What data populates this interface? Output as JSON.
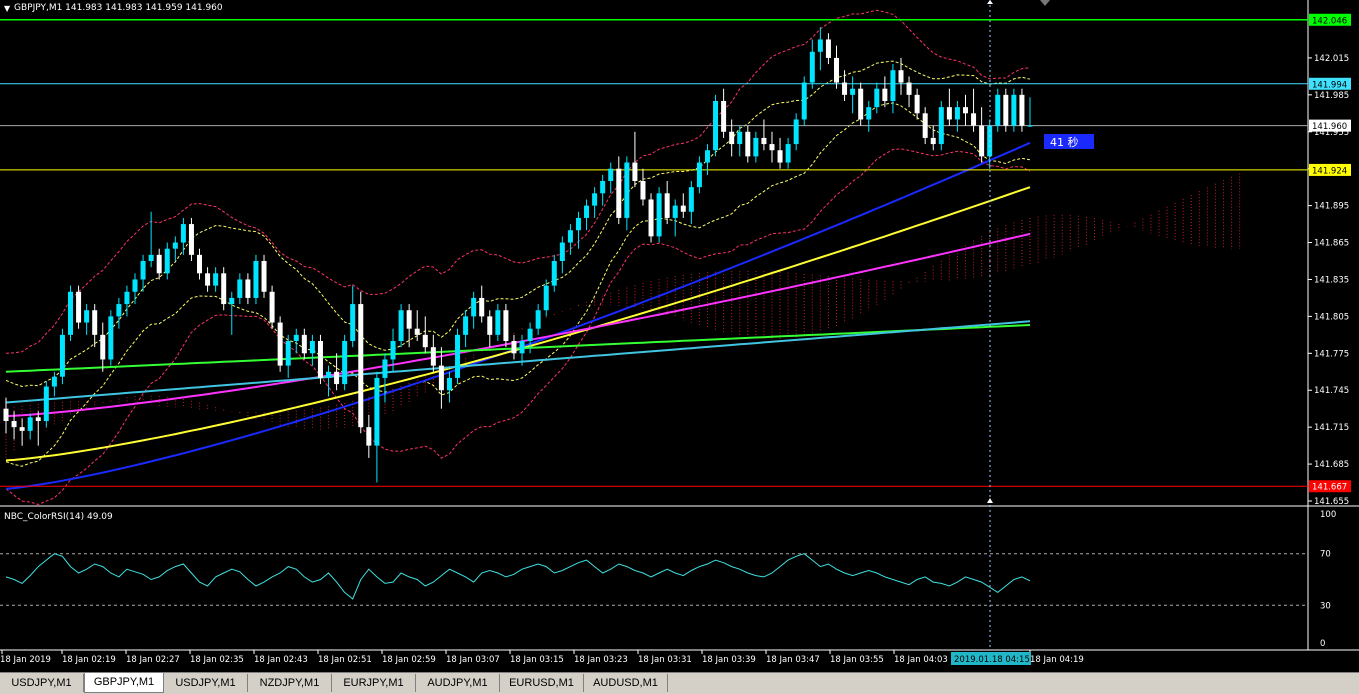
{
  "window": {
    "symbol_header": "GBPJPY,M1  141.983 141.983 141.959 141.960",
    "menu_glyph": "▼"
  },
  "price_scale": {
    "ticks": [
      "142.015",
      "141.985",
      "141.955",
      "141.925",
      "141.895",
      "141.865",
      "141.835",
      "141.805",
      "141.775",
      "141.745",
      "141.715",
      "141.685",
      "141.655"
    ],
    "label_green": "142.046",
    "label_cyan": "141.994",
    "label_current": "141.960",
    "label_yellow": "141.924",
    "label_red": "141.667"
  },
  "countdown": {
    "text": "41 秒"
  },
  "indicator": {
    "label": "NBC_ColorRSI(14) 49.09",
    "levels": [
      "100",
      "70",
      "30",
      "0"
    ]
  },
  "time_axis": {
    "labels": [
      "18 Jan 2019",
      "18 Jan 02:19",
      "18 Jan 02:27",
      "18 Jan 02:35",
      "18 Jan 02:43",
      "18 Jan 02:51",
      "18 Jan 02:59",
      "18 Jan 03:07",
      "18 Jan 03:15",
      "18 Jan 03:23",
      "18 Jan 03:31",
      "18 Jan 03:39",
      "18 Jan 03:47",
      "18 Jan 03:55",
      "18 Jan 04:03",
      "18 Jan 04:19"
    ],
    "crosshair_time": "2019.01.18 04:15"
  },
  "tabs": [
    {
      "label": "USDJPY,M1",
      "active": false
    },
    {
      "label": "GBPJPY,M1",
      "active": true
    },
    {
      "label": "USDJPY,M1",
      "active": false
    },
    {
      "label": "NZDJPY,M1",
      "active": false
    },
    {
      "label": "EURJPY,M1",
      "active": false
    },
    {
      "label": "AUDJPY,M1",
      "active": false
    },
    {
      "label": "EURUSD,M1",
      "active": false
    },
    {
      "label": "AUDUSD,M1",
      "active": false
    }
  ],
  "colors": {
    "bull": "#00e5ff",
    "bear": "#ffffff",
    "sma_fast": "#1a2aff",
    "sma_mid": "#ffff33",
    "sma_slow": "#ff33ff",
    "sma_long_green": "#33ff33",
    "sma_long_cyan": "#40c4e0",
    "bollinger": "#ff3366",
    "envelope": "#ffff66",
    "line_green": "#00ff00",
    "line_cyan": "#40e0ff",
    "line_yellow": "#ffff00",
    "line_red": "#ff0000",
    "rsi": "#40e0e0"
  },
  "chart_data": {
    "type": "candlestick",
    "timeframe": "M1",
    "symbol": "GBPJPY",
    "ylim": [
      141.655,
      142.045
    ],
    "horizontal_levels": {
      "green": 142.046,
      "cyan": 141.994,
      "current": 141.96,
      "yellow": 141.924,
      "red": 141.667
    },
    "candles": [
      [
        141.73,
        141.739,
        141.71,
        141.72
      ],
      [
        141.72,
        141.728,
        141.705,
        141.715
      ],
      [
        141.715,
        141.722,
        141.7,
        141.712
      ],
      [
        141.712,
        141.726,
        141.705,
        141.723
      ],
      [
        141.723,
        141.728,
        141.7,
        141.72
      ],
      [
        141.72,
        141.752,
        141.715,
        141.748
      ],
      [
        141.748,
        141.76,
        141.74,
        141.756
      ],
      [
        141.756,
        141.795,
        141.75,
        141.79
      ],
      [
        141.79,
        141.83,
        141.785,
        141.825
      ],
      [
        141.825,
        141.83,
        141.795,
        141.8
      ],
      [
        141.8,
        141.815,
        141.79,
        141.81
      ],
      [
        141.81,
        141.815,
        141.78,
        141.79
      ],
      [
        141.79,
        141.8,
        141.76,
        141.77
      ],
      [
        141.77,
        141.81,
        141.765,
        141.805
      ],
      [
        141.805,
        141.82,
        141.795,
        141.815
      ],
      [
        141.815,
        141.83,
        141.805,
        141.825
      ],
      [
        141.825,
        141.84,
        141.815,
        141.835
      ],
      [
        141.835,
        141.855,
        141.825,
        141.85
      ],
      [
        141.85,
        141.89,
        141.845,
        141.855
      ],
      [
        141.855,
        141.86,
        141.835,
        141.84
      ],
      [
        141.84,
        141.865,
        141.835,
        141.86
      ],
      [
        141.86,
        141.87,
        141.85,
        141.865
      ],
      [
        141.865,
        141.885,
        141.855,
        141.88
      ],
      [
        141.88,
        141.885,
        141.85,
        141.855
      ],
      [
        141.855,
        141.86,
        141.835,
        141.84
      ],
      [
        141.84,
        141.845,
        141.825,
        141.83
      ],
      [
        141.83,
        141.845,
        141.825,
        141.84
      ],
      [
        141.84,
        141.845,
        141.81,
        141.815
      ],
      [
        141.815,
        141.825,
        141.79,
        141.82
      ],
      [
        141.82,
        141.84,
        141.815,
        141.835
      ],
      [
        141.835,
        141.84,
        141.815,
        141.82
      ],
      [
        141.82,
        141.855,
        141.815,
        141.85
      ],
      [
        141.85,
        141.855,
        141.82,
        141.825
      ],
      [
        141.825,
        141.83,
        141.795,
        141.8
      ],
      [
        141.8,
        141.805,
        141.76,
        141.765
      ],
      [
        141.765,
        141.79,
        141.755,
        141.785
      ],
      [
        141.785,
        141.795,
        141.775,
        141.79
      ],
      [
        141.79,
        141.795,
        141.77,
        141.775
      ],
      [
        141.775,
        141.79,
        141.765,
        141.785
      ],
      [
        141.785,
        141.79,
        141.75,
        141.755
      ],
      [
        141.755,
        141.765,
        141.74,
        141.76
      ],
      [
        141.76,
        141.775,
        141.745,
        141.75
      ],
      [
        141.75,
        141.79,
        141.745,
        141.785
      ],
      [
        141.785,
        141.83,
        141.78,
        141.815
      ],
      [
        141.815,
        141.825,
        141.71,
        141.715
      ],
      [
        141.715,
        141.725,
        141.69,
        141.7
      ],
      [
        141.7,
        141.76,
        141.67,
        141.755
      ],
      [
        141.755,
        141.775,
        141.735,
        141.77
      ],
      [
        141.77,
        141.795,
        141.76,
        141.785
      ],
      [
        141.785,
        141.815,
        141.78,
        141.81
      ],
      [
        141.81,
        141.815,
        141.78,
        141.795
      ],
      [
        141.795,
        141.81,
        141.785,
        141.79
      ],
      [
        141.79,
        141.805,
        141.775,
        141.78
      ],
      [
        141.78,
        141.79,
        141.76,
        141.765
      ],
      [
        141.765,
        141.78,
        141.73,
        141.745
      ],
      [
        141.745,
        141.76,
        141.735,
        141.755
      ],
      [
        141.755,
        141.795,
        141.75,
        141.79
      ],
      [
        141.79,
        141.81,
        141.78,
        141.805
      ],
      [
        141.805,
        141.825,
        141.795,
        141.82
      ],
      [
        141.82,
        141.83,
        141.8,
        141.805
      ],
      [
        141.805,
        141.81,
        141.78,
        141.79
      ],
      [
        141.79,
        141.815,
        141.785,
        141.81
      ],
      [
        141.81,
        141.815,
        141.78,
        141.785
      ],
      [
        141.785,
        141.79,
        141.77,
        141.775
      ],
      [
        141.775,
        141.79,
        141.765,
        141.785
      ],
      [
        141.785,
        141.8,
        141.775,
        141.795
      ],
      [
        141.795,
        141.815,
        141.79,
        141.81
      ],
      [
        141.81,
        141.835,
        141.805,
        141.83
      ],
      [
        141.83,
        141.855,
        141.825,
        141.85
      ],
      [
        141.85,
        141.87,
        141.84,
        141.865
      ],
      [
        141.865,
        141.88,
        141.855,
        141.875
      ],
      [
        141.875,
        141.89,
        141.86,
        141.885
      ],
      [
        141.885,
        141.9,
        141.875,
        141.895
      ],
      [
        141.895,
        141.91,
        141.885,
        141.905
      ],
      [
        141.905,
        141.92,
        141.895,
        141.915
      ],
      [
        141.915,
        141.93,
        141.905,
        141.925
      ],
      [
        141.925,
        141.935,
        141.88,
        141.885
      ],
      [
        141.885,
        141.935,
        141.875,
        141.93
      ],
      [
        141.93,
        141.955,
        141.91,
        141.915
      ],
      [
        141.915,
        141.925,
        141.895,
        141.9
      ],
      [
        141.9,
        141.905,
        141.865,
        141.87
      ],
      [
        141.87,
        141.91,
        141.865,
        141.905
      ],
      [
        141.905,
        141.915,
        141.88,
        141.885
      ],
      [
        141.885,
        141.9,
        141.87,
        141.895
      ],
      [
        141.895,
        141.905,
        141.885,
        141.89
      ],
      [
        141.89,
        141.915,
        141.88,
        141.91
      ],
      [
        141.91,
        141.935,
        141.905,
        141.93
      ],
      [
        141.93,
        141.945,
        141.92,
        141.94
      ],
      [
        141.94,
        141.985,
        141.935,
        141.98
      ],
      [
        141.98,
        141.99,
        141.95,
        141.955
      ],
      [
        141.955,
        141.965,
        141.935,
        141.945
      ],
      [
        141.945,
        141.96,
        141.935,
        141.955
      ],
      [
        141.955,
        141.96,
        141.93,
        141.935
      ],
      [
        141.935,
        141.955,
        141.93,
        141.95
      ],
      [
        141.95,
        141.965,
        141.94,
        141.945
      ],
      [
        141.945,
        141.955,
        141.93,
        141.94
      ],
      [
        141.94,
        141.95,
        141.925,
        141.93
      ],
      [
        141.93,
        141.95,
        141.925,
        141.945
      ],
      [
        141.945,
        141.97,
        141.94,
        141.965
      ],
      [
        141.965,
        142.0,
        141.96,
        141.995
      ],
      [
        141.995,
        142.03,
        141.99,
        142.02
      ],
      [
        142.02,
        142.04,
        142.005,
        142.03
      ],
      [
        142.03,
        142.035,
        142.01,
        142.015
      ],
      [
        142.015,
        142.025,
        141.99,
        141.995
      ],
      [
        141.995,
        142.005,
        141.98,
        141.985
      ],
      [
        141.985,
        142.0,
        141.97,
        141.99
      ],
      [
        141.99,
        141.995,
        141.96,
        141.965
      ],
      [
        141.965,
        141.98,
        141.955,
        141.975
      ],
      [
        141.975,
        141.995,
        141.97,
        141.99
      ],
      [
        141.99,
        142.0,
        141.975,
        141.98
      ],
      [
        141.98,
        142.01,
        141.97,
        142.005
      ],
      [
        142.005,
        142.015,
        141.985,
        141.995
      ],
      [
        141.995,
        142.0,
        141.975,
        141.985
      ],
      [
        141.985,
        141.99,
        141.965,
        141.97
      ],
      [
        141.97,
        141.975,
        141.945,
        141.95
      ],
      [
        141.95,
        141.96,
        141.94,
        141.945
      ],
      [
        141.945,
        141.98,
        141.94,
        141.975
      ],
      [
        141.975,
        141.99,
        141.96,
        141.965
      ],
      [
        141.965,
        141.98,
        141.955,
        141.975
      ],
      [
        141.975,
        141.985,
        141.96,
        141.97
      ],
      [
        141.97,
        141.99,
        141.955,
        141.96
      ],
      [
        141.96,
        141.975,
        141.93,
        141.935
      ],
      [
        141.935,
        141.965,
        141.925,
        141.96
      ],
      [
        141.96,
        141.99,
        141.955,
        141.985
      ],
      [
        141.985,
        141.99,
        141.955,
        141.96
      ],
      [
        141.96,
        141.99,
        141.955,
        141.985
      ],
      [
        141.985,
        141.99,
        141.955,
        141.96
      ],
      [
        141.96,
        141.983,
        141.959,
        141.96
      ]
    ],
    "moving_averages": [
      {
        "color": "sma_fast",
        "start": 141.665,
        "end": 141.946
      },
      {
        "color": "sma_mid",
        "start": 141.688,
        "end": 141.91
      },
      {
        "color": "sma_slow",
        "start": 141.724,
        "end": 141.872
      },
      {
        "color": "sma_long_green",
        "start": 141.76,
        "end": 141.798
      },
      {
        "color": "sma_long_cyan",
        "start": 141.735,
        "end": 141.801
      }
    ],
    "rsi": {
      "period": 14,
      "value": 49.09,
      "ylim": [
        0,
        100
      ],
      "levels": [
        70,
        30
      ],
      "values": [
        52,
        50,
        47,
        53,
        60,
        65,
        70,
        68,
        60,
        55,
        58,
        62,
        60,
        55,
        52,
        58,
        56,
        54,
        50,
        52,
        57,
        60,
        62,
        55,
        48,
        45,
        52,
        55,
        58,
        56,
        50,
        45,
        48,
        52,
        55,
        60,
        58,
        52,
        48,
        50,
        55,
        48,
        40,
        35,
        50,
        58,
        52,
        47,
        48,
        55,
        52,
        50,
        45,
        48,
        53,
        58,
        55,
        52,
        48,
        55,
        57,
        55,
        52,
        54,
        58,
        60,
        62,
        60,
        55,
        57,
        60,
        63,
        65,
        60,
        55,
        58,
        62,
        60,
        57,
        55,
        52,
        55,
        58,
        55,
        53,
        57,
        60,
        62,
        65,
        63,
        60,
        58,
        55,
        53,
        52,
        55,
        60,
        65,
        68,
        70,
        65,
        60,
        62,
        58,
        55,
        53,
        55,
        57,
        55,
        52,
        50,
        48,
        46,
        50,
        52,
        48,
        47,
        45,
        48,
        52,
        50,
        48,
        44,
        40,
        45,
        50,
        52,
        49
      ]
    }
  }
}
